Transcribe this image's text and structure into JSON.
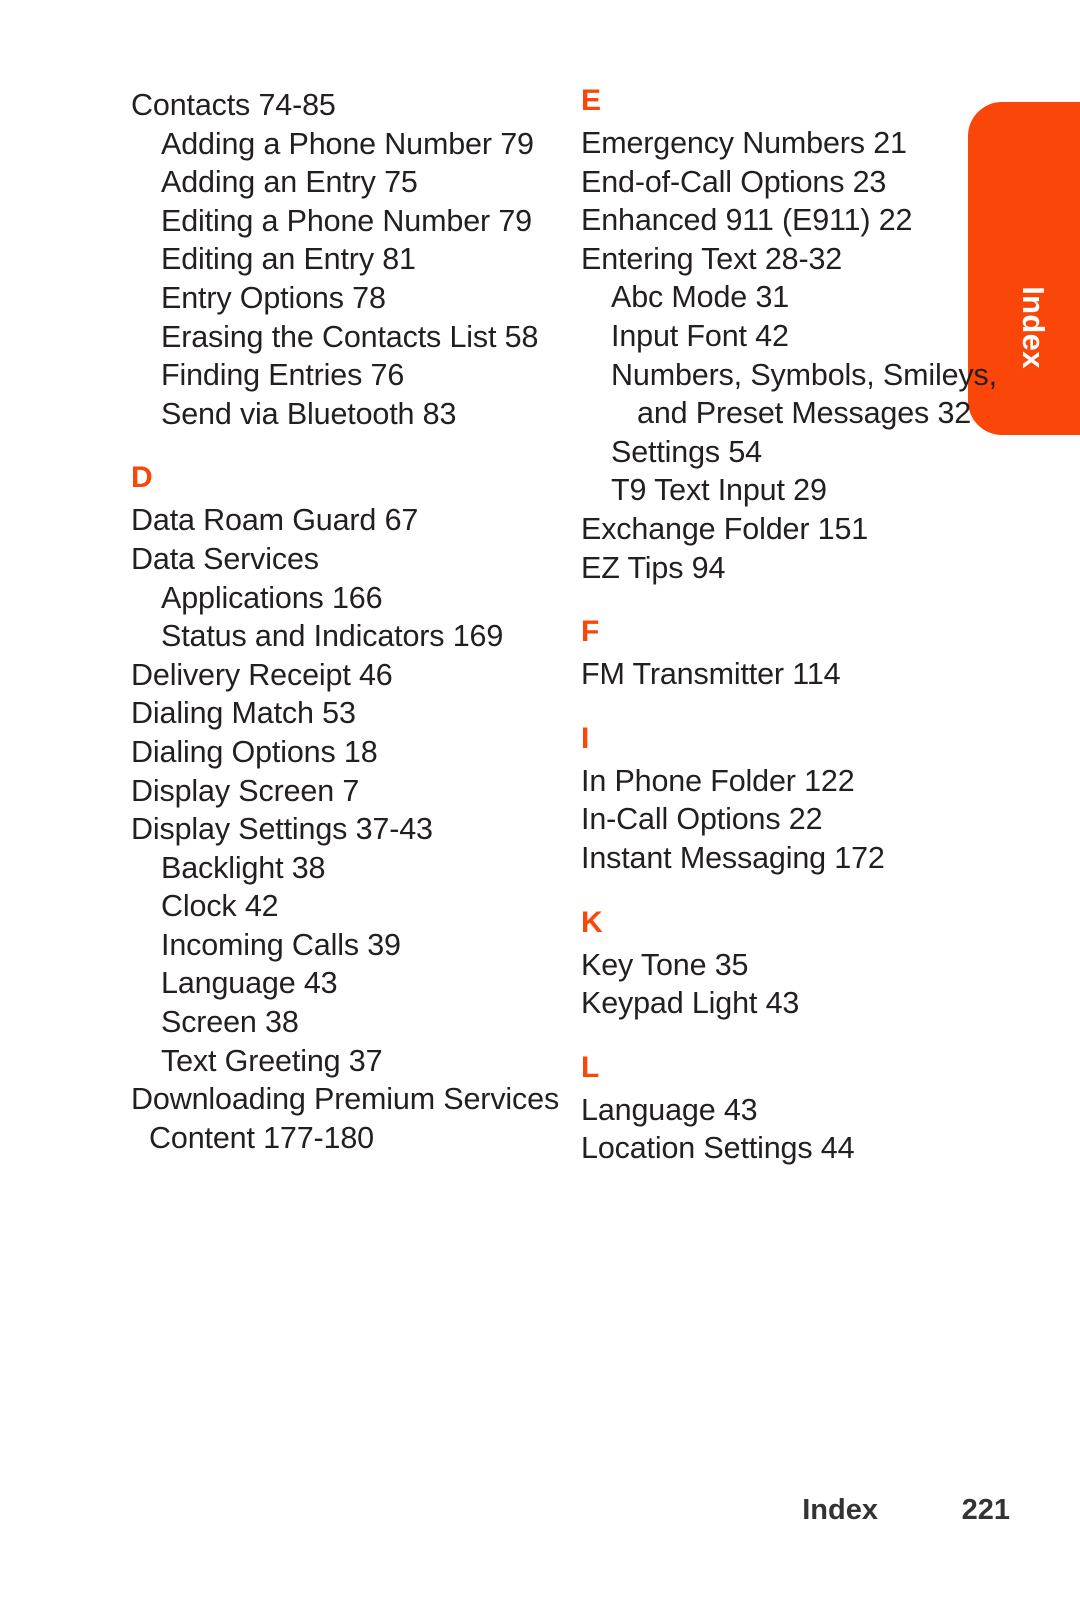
{
  "page": {
    "footer_label": "Index",
    "page_number": "221",
    "accent_color": "#fb4609",
    "text_color": "#231f20"
  },
  "side_tab": {
    "label": "Index"
  },
  "columns": [
    {
      "id": "left",
      "sections": [
        {
          "letter": "",
          "entries": [
            {
              "level": 1,
              "text": "Contacts 74-85"
            },
            {
              "level": 2,
              "text": "Adding a Phone Number 79"
            },
            {
              "level": 2,
              "text": "Adding an Entry 75"
            },
            {
              "level": 2,
              "text": "Editing a Phone Number 79"
            },
            {
              "level": 2,
              "text": "Editing an Entry 81"
            },
            {
              "level": 2,
              "text": "Entry Options 78"
            },
            {
              "level": 2,
              "text": "Erasing the Contacts List 58"
            },
            {
              "level": 2,
              "text": "Finding Entries 76"
            },
            {
              "level": 2,
              "text": "Send via Bluetooth 83"
            }
          ]
        },
        {
          "letter": "D",
          "entries": [
            {
              "level": 1,
              "text": "Data Roam Guard 67"
            },
            {
              "level": 1,
              "text": "Data Services"
            },
            {
              "level": 2,
              "text": "Applications 166"
            },
            {
              "level": 2,
              "text": "Status and Indicators 169"
            },
            {
              "level": 1,
              "text": "Delivery Receipt 46"
            },
            {
              "level": 1,
              "text": "Dialing Match 53"
            },
            {
              "level": 1,
              "text": "Dialing Options 18"
            },
            {
              "level": 1,
              "text": "Display Screen 7"
            },
            {
              "level": 1,
              "text": "Display Settings 37-43"
            },
            {
              "level": 2,
              "text": "Backlight 38"
            },
            {
              "level": 2,
              "text": "Clock 42"
            },
            {
              "level": 2,
              "text": "Incoming Calls 39"
            },
            {
              "level": 2,
              "text": "Language 43"
            },
            {
              "level": 2,
              "text": "Screen 38"
            },
            {
              "level": 2,
              "text": "Text Greeting 37"
            },
            {
              "level": 1,
              "text": "Downloading Premium Services Content 177-180"
            }
          ]
        }
      ]
    },
    {
      "id": "right",
      "sections": [
        {
          "letter": "E",
          "entries": [
            {
              "level": 1,
              "text": "Emergency Numbers 21"
            },
            {
              "level": 1,
              "text": "End-of-Call Options 23"
            },
            {
              "level": 1,
              "text": "Enhanced 911 (E911) 22"
            },
            {
              "level": 1,
              "text": "Entering Text 28-32"
            },
            {
              "level": 2,
              "text": "Abc Mode 31"
            },
            {
              "level": 2,
              "text": "Input Font 42"
            },
            {
              "level": 2,
              "text": "Numbers, Symbols, Smileys, and Preset Messages 32"
            },
            {
              "level": 2,
              "text": "Settings 54"
            },
            {
              "level": 2,
              "text": "T9 Text Input 29"
            },
            {
              "level": 1,
              "text": "Exchange Folder 151"
            },
            {
              "level": 1,
              "text": "EZ Tips 94"
            }
          ]
        },
        {
          "letter": "F",
          "entries": [
            {
              "level": 1,
              "text": "FM Transmitter 114"
            }
          ]
        },
        {
          "letter": "I",
          "entries": [
            {
              "level": 1,
              "text": "In Phone Folder 122"
            },
            {
              "level": 1,
              "text": "In-Call Options 22"
            },
            {
              "level": 1,
              "text": "Instant Messaging 172"
            }
          ]
        },
        {
          "letter": "K",
          "entries": [
            {
              "level": 1,
              "text": "Key Tone 35"
            },
            {
              "level": 1,
              "text": "Keypad Light 43"
            }
          ]
        },
        {
          "letter": "L",
          "entries": [
            {
              "level": 1,
              "text": "Language 43"
            },
            {
              "level": 1,
              "text": "Location Settings 44"
            }
          ]
        }
      ]
    }
  ]
}
